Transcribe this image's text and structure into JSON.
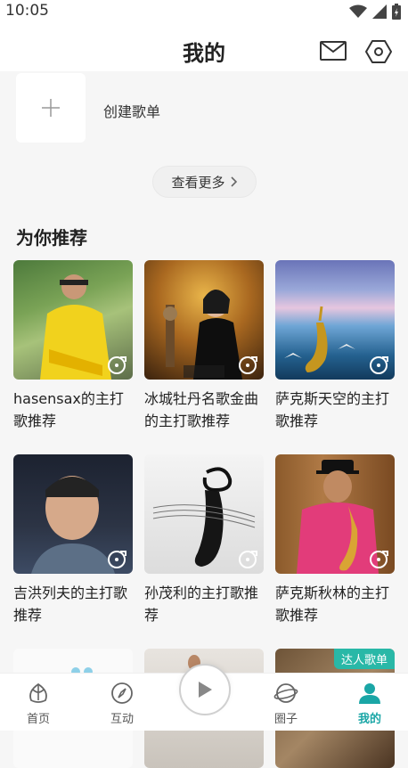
{
  "status": {
    "time": "10:05"
  },
  "header": {
    "title": "我的"
  },
  "create": {
    "label": "创建歌单"
  },
  "more": {
    "label": "查看更多"
  },
  "section": {
    "title": "为你推荐"
  },
  "playlists": [
    {
      "name": "hasensax的主打歌推荐"
    },
    {
      "name": "冰城牡丹名歌金曲的主打歌推荐"
    },
    {
      "name": "萨克斯天空的主打歌推荐"
    },
    {
      "name": "吉洪列夫的主打歌推荐"
    },
    {
      "name": "孙茂利的主打歌推荐"
    },
    {
      "name": "萨克斯秋林的主打歌推荐"
    }
  ],
  "badge": {
    "label": "达人歌单"
  },
  "tabs": [
    {
      "label": "首页",
      "icon": "home-icon"
    },
    {
      "label": "互动",
      "icon": "compass-icon"
    },
    {
      "label": "圈子",
      "icon": "planet-icon"
    },
    {
      "label": "我的",
      "icon": "profile-icon"
    }
  ],
  "colors": {
    "accent": "#1aa6a6",
    "badge": "#29b8a7"
  }
}
